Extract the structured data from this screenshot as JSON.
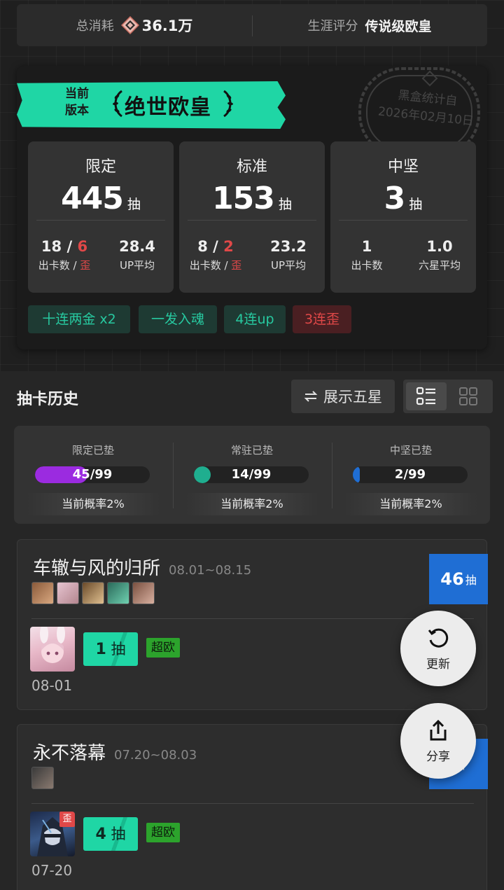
{
  "summary": {
    "total_cost_label": "总消耗",
    "total_cost_value": "36.1万",
    "career_label": "生涯评分",
    "career_value": "传说级欧皇"
  },
  "rank_card": {
    "banner_label": "当前\n版本",
    "banner_title": "绝世欧皇",
    "stamp_line1": "黑盒统计自",
    "stamp_line2": "2026年02月10日",
    "stats": [
      {
        "title": "限定",
        "total": "445",
        "unit": "抽",
        "left_val_a": "18",
        "left_val_slash": " / ",
        "left_val_b": "6",
        "left_sub_a": "出卡数 / ",
        "left_sub_b": "歪",
        "right_val": "28.4",
        "right_sub": "UP平均"
      },
      {
        "title": "标准",
        "total": "153",
        "unit": "抽",
        "left_val_a": "8",
        "left_val_slash": " / ",
        "left_val_b": "2",
        "left_sub_a": "出卡数 / ",
        "left_sub_b": "歪",
        "right_val": "23.2",
        "right_sub": "UP平均"
      },
      {
        "title": "中坚",
        "total": "3",
        "unit": "抽",
        "left_val_a": "1",
        "left_val_slash": "",
        "left_val_b": "",
        "left_sub_a": "出卡数",
        "left_sub_b": "",
        "right_val": "1.0",
        "right_sub": "六星平均"
      }
    ],
    "tags": [
      {
        "label": "十连两金  x2",
        "type": "green"
      },
      {
        "label": "一发入魂",
        "type": "green"
      },
      {
        "label": "4连up",
        "type": "green"
      },
      {
        "label": "3连歪",
        "type": "red"
      }
    ]
  },
  "history": {
    "title": "抽卡历史",
    "five_star_button": "展示五星",
    "pity": [
      {
        "label": "限定已垫",
        "value_text": "45/99",
        "fraction": 0.4545,
        "color": "#9b2be0",
        "rate": "当前概率2%"
      },
      {
        "label": "常驻已垫",
        "value_text": "14/99",
        "fraction": 0.1414,
        "color": "#1fae8f",
        "rate": "当前概率2%"
      },
      {
        "label": "中坚已垫",
        "value_text": "2/99",
        "fraction": 0.0202,
        "color": "#1f6ed4",
        "rate": "当前概率2%"
      }
    ],
    "banners": [
      {
        "name": "车辙与风的归所",
        "dates": "08.01~08.15",
        "pull_count": "46",
        "pull_unit": "抽",
        "result_pulls": "1",
        "result_unit": "抽",
        "luck_tag": "超欧",
        "day": "08-01",
        "off_mark": ""
      },
      {
        "name": "永不落幕",
        "dates": "07.20~08.03",
        "pull_count": "",
        "pull_unit": "抽",
        "result_pulls": "4",
        "result_unit": "抽",
        "luck_tag": "超欧",
        "day": "07-20",
        "off_mark": "歪"
      }
    ]
  },
  "fabs": {
    "refresh_label": "更新",
    "share_label": "分享"
  },
  "colors": {
    "accent_green": "#1fd6a5",
    "accent_blue": "#1f6ed4",
    "warn_red": "#e04848"
  }
}
